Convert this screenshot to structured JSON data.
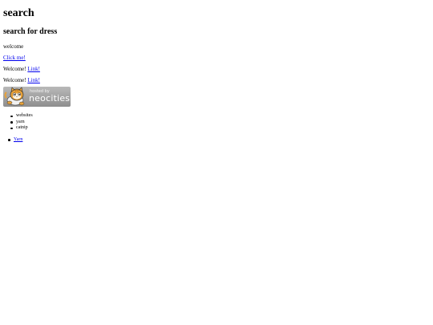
{
  "page": {
    "title": "search",
    "subtitle": "search for dress",
    "welcome": "welcome",
    "click_link": "Click me!",
    "welcome_prefix_1": "Welcome!",
    "link_1": "Link!",
    "welcome_prefix_2": "Welcome!",
    "link_2": "Link!"
  },
  "badge": {
    "hosted_by": "hosted by",
    "name": "neocities",
    "icon": "neocities-cat-icon"
  },
  "list": {
    "items": [
      "websites",
      "yarn",
      "catnip"
    ]
  },
  "nav": {
    "items": [
      "Yarn"
    ]
  },
  "colors": {
    "link": "#0000ee",
    "badge_bg": "#a3a3a3",
    "cat_orange": "#e8a23a"
  }
}
